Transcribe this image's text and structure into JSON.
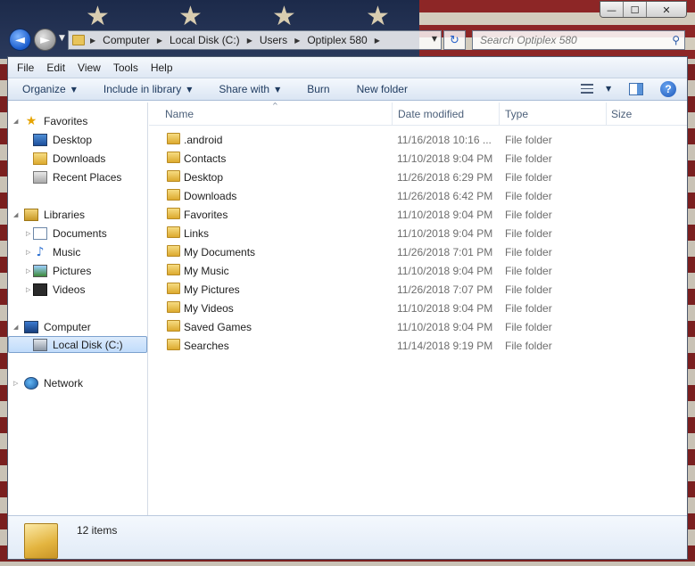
{
  "window": {
    "caption_buttons": [
      "—",
      "☐",
      "✕"
    ]
  },
  "nav": {
    "back_glyph": "◄",
    "forward_glyph": "►",
    "history_glyph": "▼"
  },
  "address": {
    "crumbs": [
      "Computer",
      "Local Disk (C:)",
      "Users",
      "Optiplex 580"
    ],
    "separator": "▶",
    "dropdown": "▼"
  },
  "refresh_glyph": "↻",
  "search": {
    "placeholder": "Search Optiplex 580"
  },
  "menu": [
    "File",
    "Edit",
    "View",
    "Tools",
    "Help"
  ],
  "commands": {
    "organize": "Organize",
    "include_in_library": "Include in library",
    "share_with": "Share with",
    "burn": "Burn",
    "new_folder": "New folder",
    "dropdown_glyph": "▼",
    "help_glyph": "?"
  },
  "navpane": {
    "favorites": "Favorites",
    "desktop": "Desktop",
    "downloads": "Downloads",
    "recent_places": "Recent Places",
    "libraries": "Libraries",
    "documents": "Documents",
    "music": "Music",
    "pictures": "Pictures",
    "videos": "Videos",
    "computer": "Computer",
    "local_disk": "Local Disk (C:)",
    "network": "Network"
  },
  "columns": {
    "name": "Name",
    "date_modified": "Date modified",
    "type": "Type",
    "size": "Size"
  },
  "files": [
    {
      "name": ".android",
      "date": "11/16/2018 10:16 ...",
      "type": "File folder"
    },
    {
      "name": "Contacts",
      "date": "11/10/2018 9:04 PM",
      "type": "File folder"
    },
    {
      "name": "Desktop",
      "date": "11/26/2018 6:29 PM",
      "type": "File folder"
    },
    {
      "name": "Downloads",
      "date": "11/26/2018 6:42 PM",
      "type": "File folder"
    },
    {
      "name": "Favorites",
      "date": "11/10/2018 9:04 PM",
      "type": "File folder"
    },
    {
      "name": "Links",
      "date": "11/10/2018 9:04 PM",
      "type": "File folder"
    },
    {
      "name": "My Documents",
      "date": "11/26/2018 7:01 PM",
      "type": "File folder"
    },
    {
      "name": "My Music",
      "date": "11/10/2018 9:04 PM",
      "type": "File folder"
    },
    {
      "name": "My Pictures",
      "date": "11/26/2018 7:07 PM",
      "type": "File folder"
    },
    {
      "name": "My Videos",
      "date": "11/10/2018 9:04 PM",
      "type": "File folder"
    },
    {
      "name": "Saved Games",
      "date": "11/10/2018 9:04 PM",
      "type": "File folder"
    },
    {
      "name": "Searches",
      "date": "11/14/2018 9:19 PM",
      "type": "File folder"
    }
  ],
  "status": {
    "item_count": "12 items"
  },
  "colors": {
    "selection": "#c1dcfb",
    "accent": "#1e3a5f"
  }
}
